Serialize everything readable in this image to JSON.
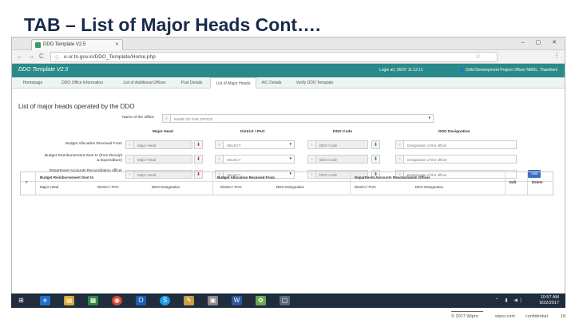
{
  "slide": {
    "title": "TAB – List of Major Heads Cont…."
  },
  "browser": {
    "tab_title": "DDO Template V2.5",
    "url": "e-sr.tn.gov.in/DDO_Template/Home.php",
    "back": "←",
    "forward": "→",
    "reload": "C",
    "win_controls": "– ▢ ✕"
  },
  "app": {
    "name": "DDO Template V2.5",
    "login": "Login at | 26/07 11:12:11",
    "user": "👤 Child Development Project Officer NMSL, Thanthoni"
  },
  "tabs": [
    "Homepage",
    "DDO Office Information",
    "List of Additional Offices",
    "Post Details",
    "List of Major Heads",
    "A/C Details",
    "Verify DDO Template"
  ],
  "section": {
    "title": "List of major heads operated by the DDO"
  },
  "form": {
    "office_label": "Name of the Office",
    "office_value": "NAME OF THE OFFICE",
    "col_major_head": "Major Head",
    "col_district": "District / PAO",
    "col_ddo_code": "DDO Code",
    "col_ddo_designation": "DDO Designation",
    "rows": [
      {
        "label": "Budget Allocation Received From",
        "major": "Major Head",
        "district": "SELECT",
        "code": "DDO Code",
        "designation": "Designation of the officer"
      },
      {
        "label": "Budget Reimbursement Sent to (from Receipt & Expenditure)",
        "major": "Major Head",
        "district": "SELECT",
        "code": "DDO Code",
        "designation": "Designation of the officer"
      },
      {
        "label": "Department Accounts Reconciliation officer",
        "major": "Major Head",
        "district": "SELECT",
        "code": "DDO Code",
        "designation": "Designation of the officer"
      }
    ],
    "add_label": "Add"
  },
  "table": {
    "col_num": "#",
    "group1": "Budget Reimbursement Sent to",
    "group2": "Budget Allocation Received From",
    "group3": "Department Accounts Reconciliation Officer",
    "edit": "Edit",
    "delete": "Delete",
    "sub": [
      "Major Head",
      "District / PAO",
      "DDO Designation",
      "District / PAO",
      "DDO Designation",
      "District / PAO",
      "DDO Designation"
    ]
  },
  "taskbar": {
    "time": "10:57 AM",
    "date": "9/22/2017"
  },
  "footer": {
    "copyright": "© 2017 Wipro",
    "site": "wipro.com",
    "tagline": "confidential",
    "page": "18"
  }
}
